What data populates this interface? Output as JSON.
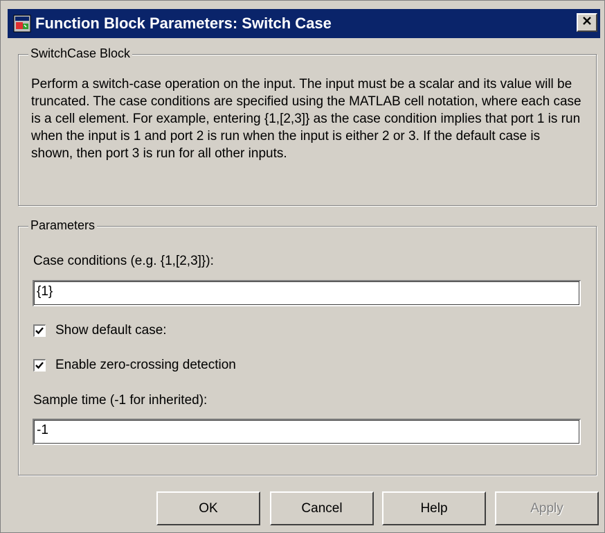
{
  "window": {
    "title": "Function Block Parameters: Switch Case"
  },
  "block_group": {
    "legend": "SwitchCase Block",
    "description": "Perform a switch-case operation on the input.  The input must be a scalar and its value will be truncated.  The case conditions are specified using the MATLAB cell notation, where each case is a cell element.  For example, entering {1,[2,3]} as the case condition implies that port 1 is run when the input is 1 and port 2 is run when the input is either 2 or 3.  If the default case is shown, then port 3 is run for all other inputs."
  },
  "parameters": {
    "legend": "Parameters",
    "case_conditions_label": "Case conditions (e.g. {1,[2,3]}):",
    "case_conditions_value": "{1}",
    "show_default_label": "Show default case:",
    "show_default_checked": true,
    "zero_crossing_label": "Enable zero-crossing detection",
    "zero_crossing_checked": true,
    "sample_time_label": "Sample time (-1 for inherited):",
    "sample_time_value": "-1"
  },
  "buttons": {
    "ok": "OK",
    "cancel": "Cancel",
    "help": "Help",
    "apply": "Apply"
  },
  "icons": {
    "app": "simulink-block-icon",
    "close": "close-icon",
    "check": "checkmark-icon"
  }
}
